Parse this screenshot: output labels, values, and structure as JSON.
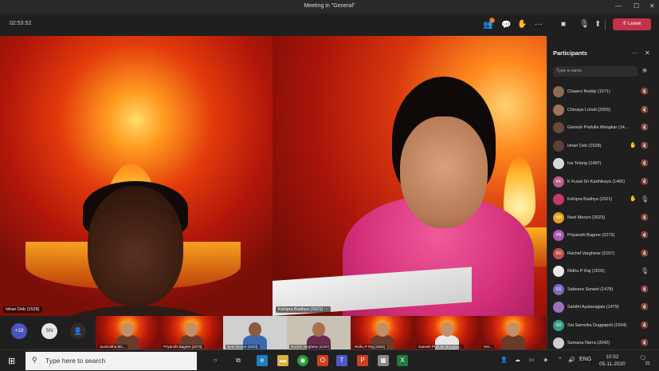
{
  "window": {
    "title": "Meeting in \"General\"",
    "minimize": "—",
    "maximize": "☐",
    "close": "✕"
  },
  "toolbar": {
    "timer": "02:53:52",
    "participants_badge": "4",
    "leave_label": "Leave"
  },
  "main_videos": [
    {
      "name": "Ishan Deb (1528)"
    },
    {
      "name": "Kshipra Badhya (1521)",
      "more": "···"
    }
  ],
  "gallery": {
    "overflow_count": "+19",
    "sn_initials": "SN",
    "tiles": [
      {
        "name": "Sushmitha Mo..."
      },
      {
        "name": "Priyanshi Bagree (2273)"
      },
      {
        "name": "Neel Menon (2023)"
      },
      {
        "name": "Rachel Varghese (2167)"
      },
      {
        "name": "Ridhu P Raj (1503)"
      },
      {
        "name": "Ganesh Prafulla Mangkar..."
      },
      {
        "name": "Mrs..."
      }
    ]
  },
  "panel": {
    "title": "Participants",
    "search_placeholder": "Type a name",
    "participants": [
      {
        "name": "Chaarvi Reddy (1071)",
        "initials": "",
        "color": "#8a6a58"
      },
      {
        "name": "Chinaya Lohoti (2055)",
        "initials": "",
        "color": "#a07060"
      },
      {
        "name": "Ganesh Prafulla Mangkar (14...",
        "initials": "",
        "color": "#6a4a3a"
      },
      {
        "name": "Ishan Deb (1528)",
        "initials": "",
        "color": "#5b4038"
      },
      {
        "name": "Iva Telang (1497)",
        "initials": "",
        "color": "#d8d8d8"
      },
      {
        "name": "K Kusal Sri Karthikeya (1465)",
        "initials": "KK",
        "color": "#b85a8a"
      },
      {
        "name": "Kshipra Badhya (1521)",
        "initials": "",
        "color": "#c23a6a"
      },
      {
        "name": "Neel Menon (2023)",
        "initials": "NM",
        "color": "#e0a020"
      },
      {
        "name": "Priyanshi Bagree (2273)",
        "initials": "PB",
        "color": "#a85ab0"
      },
      {
        "name": "Rachel Varghese (2167)",
        "initials": "RV",
        "color": "#c05050"
      },
      {
        "name": "Ridhu P Raj (1503)",
        "initials": "",
        "color": "#e8e8e8"
      },
      {
        "name": "Sabeera Suneet (1478)",
        "initials": "SS",
        "color": "#7a6ac0"
      },
      {
        "name": "Sahithi Ayalavajjala (1479)",
        "initials": "",
        "color": "#9a70c0"
      },
      {
        "name": "Sai Samvika Duggapoli (1504)",
        "initials": "SD",
        "color": "#3a9a8a"
      },
      {
        "name": "Samana Narra (2042)",
        "initials": "",
        "color": "#cfcfcf"
      }
    ]
  },
  "taskbar": {
    "search_placeholder": "Type here to search",
    "language": "ENG",
    "time": "10:52",
    "date": "05-11-2020",
    "notif_count": "21"
  }
}
